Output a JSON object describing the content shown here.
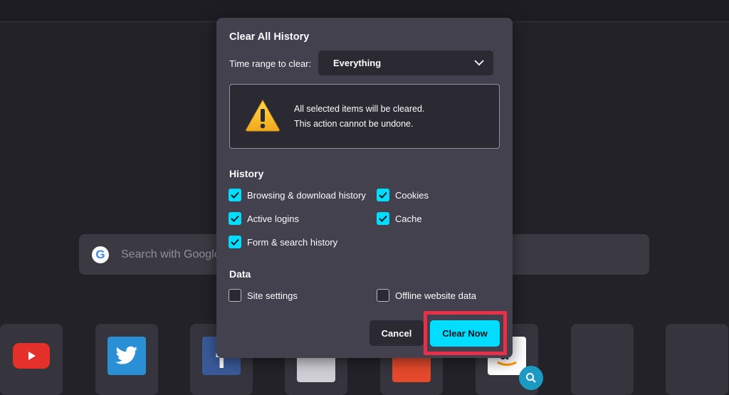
{
  "background": {
    "search_placeholder": "Search with Google",
    "google_letter": "G",
    "shortcuts": [
      {
        "name": "youtube-icon"
      },
      {
        "name": "twitter-icon"
      },
      {
        "name": "facebook-icon"
      },
      {
        "name": "wikipedia-icon"
      },
      {
        "name": "reddit-icon"
      },
      {
        "name": "amazon-icon"
      },
      {
        "name": "empty-tile"
      },
      {
        "name": "empty-tile"
      }
    ]
  },
  "dialog": {
    "title": "Clear All History",
    "time_range_label": "Time range to clear:",
    "time_range_value": "Everything",
    "warning_line1": "All selected items will be cleared.",
    "warning_line2": "This action cannot be undone.",
    "history_heading": "History",
    "history_items": [
      {
        "label": "Browsing & download history",
        "checked": true
      },
      {
        "label": "Cookies",
        "checked": true
      },
      {
        "label": "Active logins",
        "checked": true
      },
      {
        "label": "Cache",
        "checked": true
      },
      {
        "label": "Form & search history",
        "checked": true
      }
    ],
    "data_heading": "Data",
    "data_items": [
      {
        "label": "Site settings",
        "checked": false
      },
      {
        "label": "Offline website data",
        "checked": false
      }
    ],
    "cancel_label": "Cancel",
    "clear_label": "Clear Now"
  },
  "colors": {
    "accent": "#00ddff",
    "highlight": "#e8304a",
    "dialog_bg": "#42414d"
  }
}
